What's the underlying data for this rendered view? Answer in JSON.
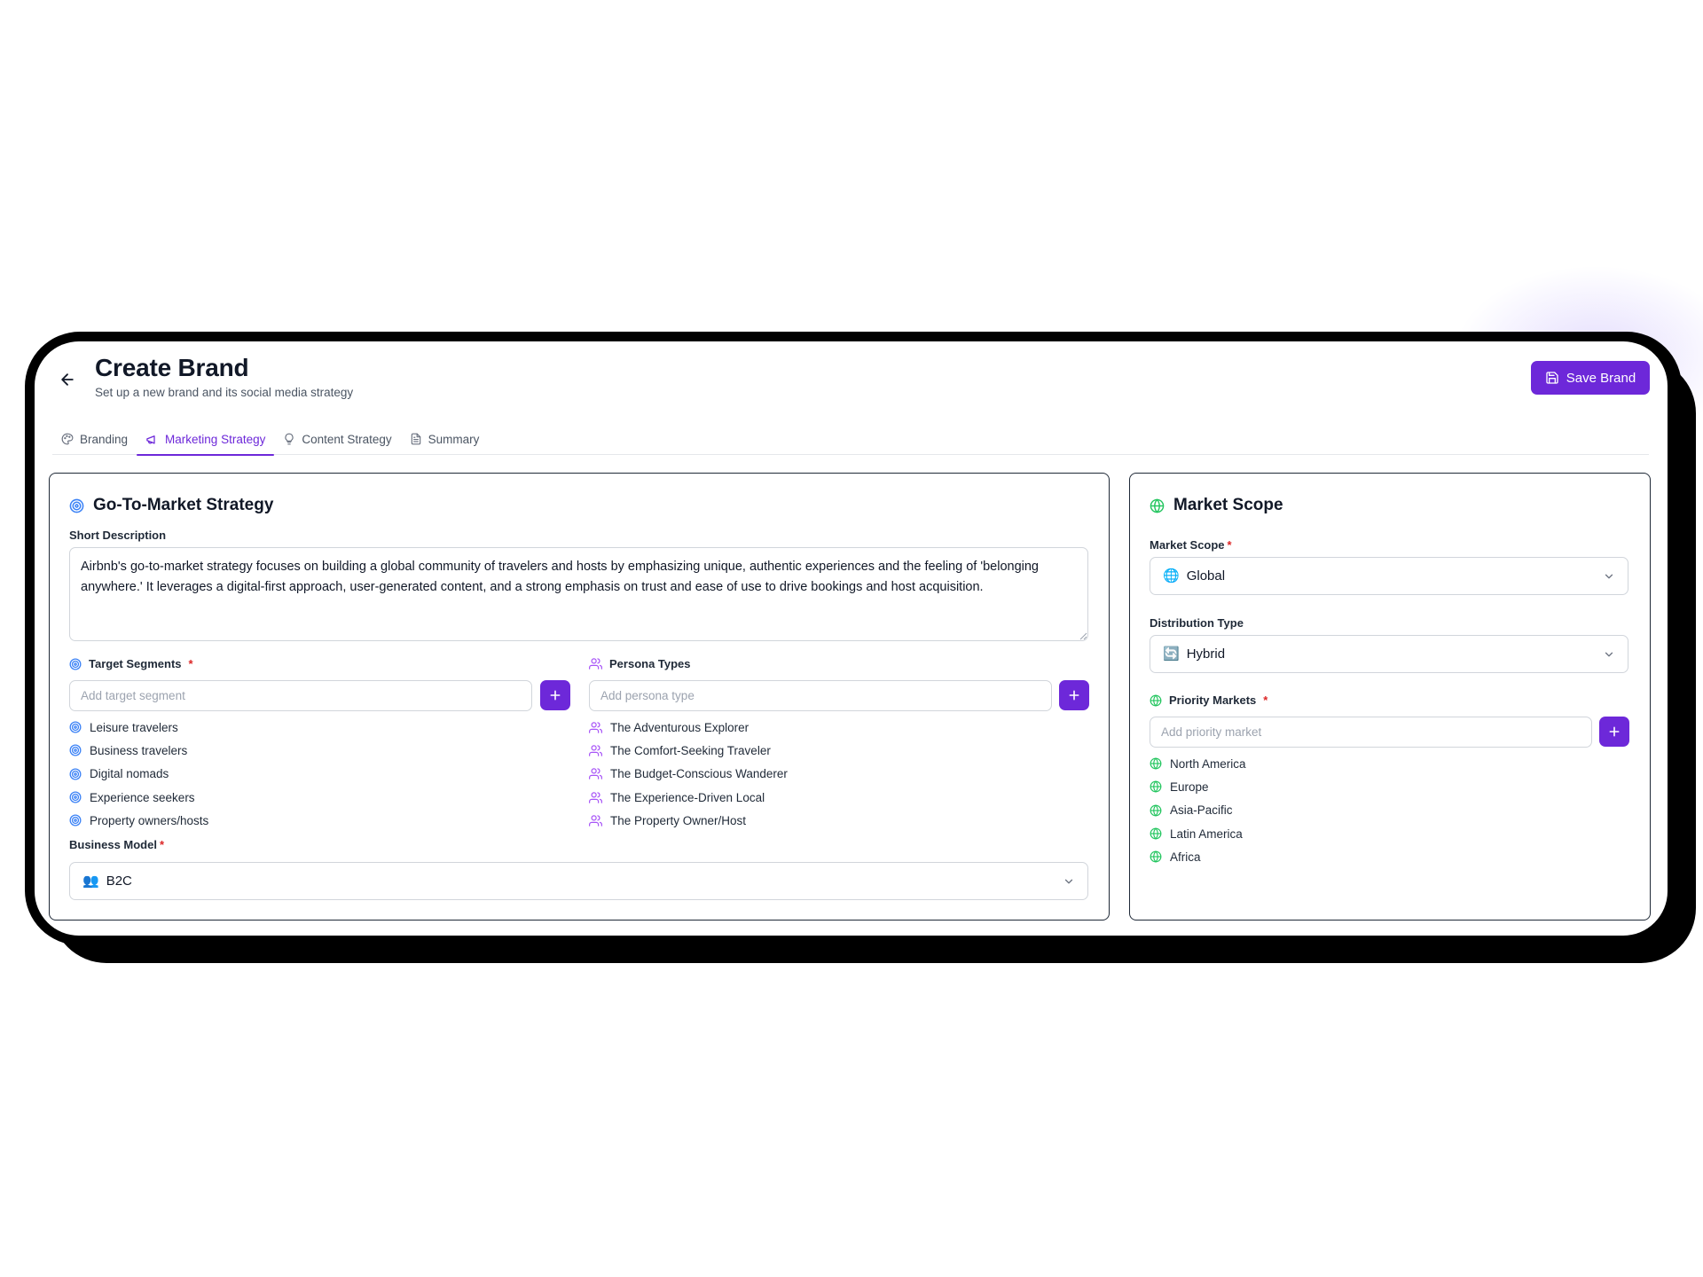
{
  "header": {
    "title": "Create Brand",
    "subtitle": "Set up a new brand and its social media strategy",
    "save_label": "Save Brand"
  },
  "tabs": [
    {
      "label": "Branding",
      "icon": "palette-icon",
      "active": false
    },
    {
      "label": "Marketing Strategy",
      "icon": "megaphone-icon",
      "active": true
    },
    {
      "label": "Content Strategy",
      "icon": "lightbulb-icon",
      "active": false
    },
    {
      "label": "Summary",
      "icon": "document-icon",
      "active": false
    }
  ],
  "go_to_market": {
    "title": "Go-To-Market Strategy",
    "short_description_label": "Short Description",
    "short_description": "Airbnb's go-to-market strategy focuses on building a global community of travelers and hosts by emphasizing unique, authentic experiences and the feeling of 'belonging anywhere.' It leverages a digital-first approach, user-generated content, and a strong emphasis on trust and ease of use to drive bookings and host acquisition.",
    "target_segments": {
      "label": "Target Segments",
      "required_mark": "*",
      "placeholder": "Add target segment",
      "items": [
        "Leisure travelers",
        "Business travelers",
        "Digital nomads",
        "Experience seekers",
        "Property owners/hosts"
      ]
    },
    "persona_types": {
      "label": "Persona Types",
      "placeholder": "Add persona type",
      "items": [
        "The Adventurous Explorer",
        "The Comfort-Seeking Traveler",
        "The Budget-Conscious Wanderer",
        "The Experience-Driven Local",
        "The Property Owner/Host"
      ]
    },
    "business_model": {
      "label": "Business Model",
      "required_mark": "*",
      "value": "B2C",
      "emoji": "👥"
    }
  },
  "market_scope": {
    "title": "Market Scope",
    "scope": {
      "label": "Market Scope",
      "required_mark": "*",
      "value": "Global",
      "emoji": "🌐"
    },
    "distribution": {
      "label": "Distribution Type",
      "value": "Hybrid",
      "emoji": "🔄"
    },
    "priority_markets": {
      "label": "Priority Markets",
      "required_mark": "*",
      "placeholder": "Add priority market",
      "items": [
        "North America",
        "Europe",
        "Asia-Pacific",
        "Latin America",
        "Africa"
      ]
    }
  },
  "colors": {
    "accent": "#6d28d9",
    "target_icon": "#3b82f6",
    "persona_icon": "#a855f7",
    "globe_icon": "#22c55e",
    "required": "#dc2626"
  }
}
